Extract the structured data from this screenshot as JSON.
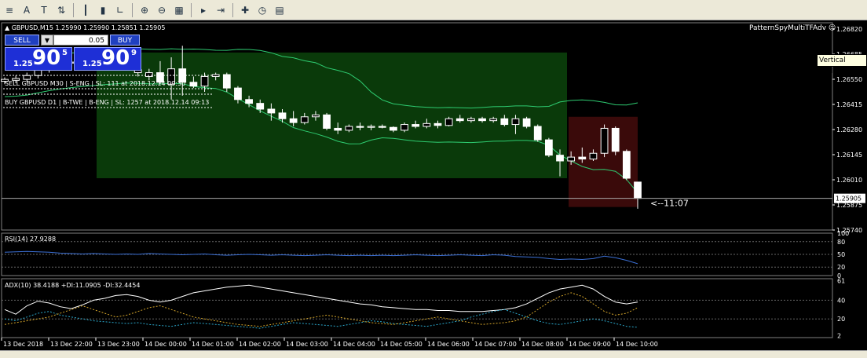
{
  "toolbar": {
    "icons": [
      "menu-icon",
      "text-icon",
      "label-icon",
      "arrows-icon",
      "bar-chart-icon",
      "candle-chart-icon",
      "line-chart-icon",
      "zoom-in-icon",
      "zoom-out-icon",
      "tile-windows-icon",
      "auto-scroll-icon",
      "chart-shift-icon",
      "indicators-icon",
      "periods-icon",
      "templates-icon"
    ]
  },
  "header": {
    "title": "▲ GBPUSD,M15  1.25990 1.25990 1.25851 1.25905",
    "ea_name": "PatternSpyMultiTFAdv ☺",
    "vertical_scale_tooltip": "Vertical scale"
  },
  "trade_panel": {
    "sell_label": "SELL",
    "buy_label": "BUY",
    "lot": "0.05",
    "sell_price_small": "1.25",
    "sell_price_big": "90",
    "sell_price_sup": "5",
    "buy_price_small": "1.25",
    "buy_price_big": "90",
    "buy_price_sup": "9"
  },
  "signals": [
    "SELL GBPUSD M30 | S-ENG | SL: 111 at 2018.12.14 09:30",
    "BUY GBPUSD D1 | B-TWE | B-ENG | SL: 1257 at 2018.12.14 09:13"
  ],
  "timer": "<--11:07",
  "price_axis": {
    "labels": [
      "1.26820",
      "1.26685",
      "1.26550",
      "1.26415",
      "1.26280",
      "1.26145",
      "1.26010",
      "1.25875",
      "1.25740"
    ],
    "current": "1.25905"
  },
  "rsi": {
    "label": "RSI(14) 27.9288",
    "levels": [
      "100",
      "80",
      "50",
      "20",
      "0"
    ]
  },
  "adx": {
    "label": "ADX(10) 38.4188 +DI:11.0905 -DI:32.4454",
    "levels": [
      "61",
      "40",
      "20",
      "2"
    ]
  },
  "time_axis": [
    "13 Dec 2018",
    "13 Dec 22:00",
    "13 Dec 23:00",
    "14 Dec 00:00",
    "14 Dec 01:00",
    "14 Dec 02:00",
    "14 Dec 03:00",
    "14 Dec 04:00",
    "14 Dec 05:00",
    "14 Dec 06:00",
    "14 Dec 07:00",
    "14 Dec 08:00",
    "14 Dec 09:00",
    "14 Dec 10:00"
  ],
  "colors": {
    "bands": "#2ecc71",
    "green_zone": "#0a3a0a",
    "red_zone": "#3a0a0a",
    "rsi_line": "#3b6fd4",
    "adx_line": "#ffffff",
    "plus_di": "#2aa6c9",
    "minus_di": "#d4a52a"
  },
  "chart_data": {
    "type": "candlestick",
    "price_range": [
      1.2574,
      1.2682
    ],
    "candles": [
      [
        1.26515,
        1.26535,
        1.265,
        1.26525
      ],
      [
        1.2652,
        1.26545,
        1.26505,
        1.2653
      ],
      [
        1.26525,
        1.2656,
        1.2651,
        1.26545
      ],
      [
        1.26545,
        1.266,
        1.2653,
        1.2658
      ],
      [
        1.26585,
        1.2662,
        1.2656,
        1.266
      ],
      [
        1.266,
        1.2662,
        1.2658,
        1.2661
      ],
      [
        1.2661,
        1.2663,
        1.2659,
        1.26615
      ],
      [
        1.26615,
        1.2664,
        1.26595,
        1.2662
      ],
      [
        1.26615,
        1.26635,
        1.266,
        1.26625
      ],
      [
        1.2662,
        1.2664,
        1.26605,
        1.2663
      ],
      [
        1.2663,
        1.2665,
        1.2661,
        1.26635
      ],
      [
        1.26635,
        1.2665,
        1.2662,
        1.2664
      ],
      [
        1.2656,
        1.2659,
        1.2654,
        1.26575
      ],
      [
        1.2654,
        1.2658,
        1.2652,
        1.2656
      ],
      [
        1.2656,
        1.2662,
        1.265,
        1.2651
      ],
      [
        1.265,
        1.2664,
        1.2642,
        1.2658
      ],
      [
        1.2658,
        1.267,
        1.2644,
        1.2651
      ],
      [
        1.2651,
        1.2654,
        1.2648,
        1.2649
      ],
      [
        1.2649,
        1.2656,
        1.2646,
        1.2654
      ],
      [
        1.2654,
        1.2656,
        1.2652,
        1.2655
      ],
      [
        1.2655,
        1.2656,
        1.2646,
        1.2648
      ],
      [
        1.2648,
        1.2649,
        1.264,
        1.2642
      ],
      [
        1.2642,
        1.2644,
        1.2638,
        1.264
      ],
      [
        1.264,
        1.2642,
        1.2635,
        1.2637
      ],
      [
        1.2637,
        1.264,
        1.2631,
        1.2635
      ],
      [
        1.2635,
        1.2637,
        1.263,
        1.2632
      ],
      [
        1.2632,
        1.2636,
        1.2628,
        1.263
      ],
      [
        1.263,
        1.2635,
        1.2629,
        1.2633
      ],
      [
        1.2633,
        1.2636,
        1.2631,
        1.2634
      ],
      [
        1.2634,
        1.2635,
        1.2626,
        1.2627
      ],
      [
        1.2627,
        1.263,
        1.2624,
        1.2626
      ],
      [
        1.2626,
        1.2629,
        1.2625,
        1.2628
      ],
      [
        1.2628,
        1.263,
        1.2626,
        1.26275
      ],
      [
        1.26275,
        1.2629,
        1.2626,
        1.2628
      ],
      [
        1.2628,
        1.2629,
        1.2627,
        1.26275
      ],
      [
        1.26275,
        1.2628,
        1.2625,
        1.2626
      ],
      [
        1.2626,
        1.263,
        1.2625,
        1.2629
      ],
      [
        1.2629,
        1.2631,
        1.2627,
        1.2628
      ],
      [
        1.2628,
        1.2632,
        1.2627,
        1.26295
      ],
      [
        1.26295,
        1.2631,
        1.2627,
        1.26285
      ],
      [
        1.26285,
        1.2633,
        1.2628,
        1.2632
      ],
      [
        1.2632,
        1.2634,
        1.263,
        1.2631
      ],
      [
        1.2631,
        1.2633,
        1.263,
        1.2632
      ],
      [
        1.2632,
        1.2633,
        1.263,
        1.2631
      ],
      [
        1.2631,
        1.2633,
        1.263,
        1.2632
      ],
      [
        1.2632,
        1.2634,
        1.2628,
        1.2629
      ],
      [
        1.2629,
        1.2634,
        1.2624,
        1.2632
      ],
      [
        1.2632,
        1.2633,
        1.2627,
        1.2628
      ],
      [
        1.2628,
        1.2629,
        1.262,
        1.2621
      ],
      [
        1.2621,
        1.2622,
        1.2612,
        1.2613
      ],
      [
        1.2613,
        1.2616,
        1.2602,
        1.261
      ],
      [
        1.261,
        1.2615,
        1.2608,
        1.2612
      ],
      [
        1.2612,
        1.2617,
        1.2609,
        1.2611
      ],
      [
        1.2611,
        1.2616,
        1.261,
        1.2614
      ],
      [
        1.2614,
        1.2629,
        1.2612,
        1.2627
      ],
      [
        1.2627,
        1.2628,
        1.2613,
        1.2615
      ],
      [
        1.2615,
        1.2616,
        1.26,
        1.2601
      ],
      [
        1.2599,
        1.2599,
        1.25851,
        1.25905
      ]
    ]
  }
}
